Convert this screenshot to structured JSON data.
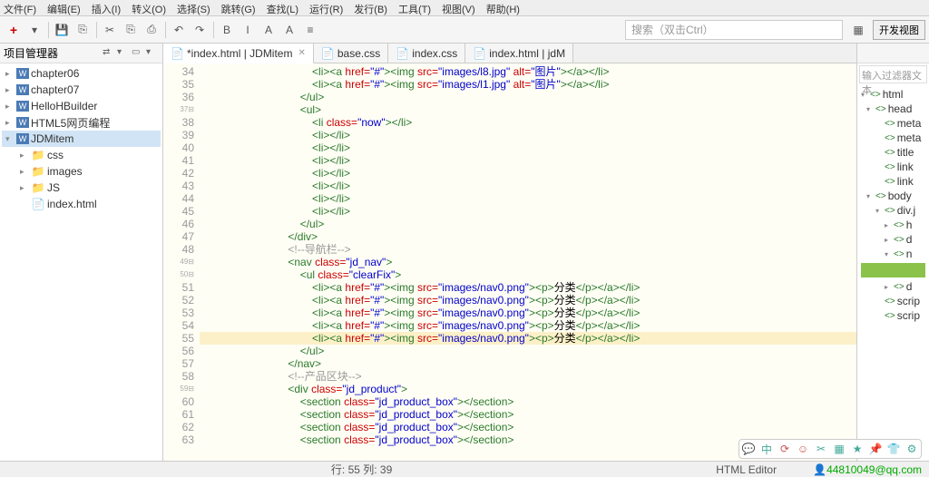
{
  "menubar": [
    "文件(F)",
    "编辑(E)",
    "插入(I)",
    "转义(O)",
    "选择(S)",
    "跳转(G)",
    "查找(L)",
    "运行(R)",
    "发行(B)",
    "工具(T)",
    "视图(V)",
    "帮助(H)"
  ],
  "toolbar": {
    "search_placeholder": "搜索（双击Ctrl）",
    "dev_view": "开发视图"
  },
  "sidebar": {
    "title": "项目管理器",
    "items": [
      {
        "label": "chapter06",
        "type": "w",
        "lvl": 1,
        "arrow": "▸"
      },
      {
        "label": "chapter07",
        "type": "w",
        "lvl": 1,
        "arrow": "▸"
      },
      {
        "label": "HelloHBuilder",
        "type": "w",
        "lvl": 1,
        "arrow": "▸"
      },
      {
        "label": "HTML5网页编程",
        "type": "w",
        "lvl": 1,
        "arrow": "▸"
      },
      {
        "label": "JDMitem",
        "type": "w",
        "lvl": 1,
        "arrow": "▾",
        "selected": true
      },
      {
        "label": "css",
        "type": "folder",
        "lvl": 2,
        "arrow": "▸"
      },
      {
        "label": "images",
        "type": "folder",
        "lvl": 2,
        "arrow": "▸"
      },
      {
        "label": "JS",
        "type": "folder",
        "lvl": 2,
        "arrow": "▸"
      },
      {
        "label": "index.html",
        "type": "file",
        "lvl": 2,
        "arrow": ""
      }
    ]
  },
  "tabs": [
    {
      "label": "*index.html | JDMitem",
      "active": true,
      "close": true
    },
    {
      "label": "base.css",
      "active": false,
      "close": false
    },
    {
      "label": "index.css",
      "active": false,
      "close": false
    },
    {
      "label": "index.html | jdM",
      "active": false,
      "close": false
    }
  ],
  "code_lines": [
    {
      "n": 34,
      "indent": 9,
      "html": "<span class='tag'>&lt;li&gt;&lt;a</span> <span class='attr'>href=</span><span class='val'>\"#\"</span><span class='tag'>&gt;&lt;img</span> <span class='attr'>src=</span><span class='val'>\"images/l8.jpg\"</span> <span class='attr'>alt=</span><span class='val'>\"图片\"</span><span class='tag'>&gt;&lt;/a&gt;&lt;/li&gt;</span>"
    },
    {
      "n": 35,
      "indent": 9,
      "html": "<span class='tag'>&lt;li&gt;&lt;a</span> <span class='attr'>href=</span><span class='val'>\"#\"</span><span class='tag'>&gt;&lt;img</span> <span class='attr'>src=</span><span class='val'>\"images/l1.jpg\"</span> <span class='attr'>alt=</span><span class='val'>\"图片\"</span><span class='tag'>&gt;&lt;/a&gt;&lt;/li&gt;</span>"
    },
    {
      "n": 36,
      "indent": 8,
      "html": "<span class='tag'>&lt;/ul&gt;</span>"
    },
    {
      "n": 37,
      "fold": true,
      "indent": 8,
      "html": "<span class='tag'>&lt;ul&gt;</span>"
    },
    {
      "n": 38,
      "indent": 9,
      "html": "<span class='tag'>&lt;li</span> <span class='attr'>class=</span><span class='val'>\"now\"</span><span class='tag'>&gt;&lt;/li&gt;</span>"
    },
    {
      "n": 39,
      "indent": 9,
      "html": "<span class='tag'>&lt;li&gt;&lt;/li&gt;</span>"
    },
    {
      "n": 40,
      "indent": 9,
      "html": "<span class='tag'>&lt;li&gt;&lt;/li&gt;</span>"
    },
    {
      "n": 41,
      "indent": 9,
      "html": "<span class='tag'>&lt;li&gt;&lt;/li&gt;</span>"
    },
    {
      "n": 42,
      "indent": 9,
      "html": "<span class='tag'>&lt;li&gt;&lt;/li&gt;</span>"
    },
    {
      "n": 43,
      "indent": 9,
      "html": "<span class='tag'>&lt;li&gt;&lt;/li&gt;</span>"
    },
    {
      "n": 44,
      "indent": 9,
      "html": "<span class='tag'>&lt;li&gt;&lt;/li&gt;</span>"
    },
    {
      "n": 45,
      "indent": 9,
      "html": "<span class='tag'>&lt;li&gt;&lt;/li&gt;</span>"
    },
    {
      "n": 46,
      "indent": 8,
      "html": "<span class='tag'>&lt;/ul&gt;</span>"
    },
    {
      "n": 47,
      "indent": 7,
      "html": "<span class='tag'>&lt;/div&gt;</span>"
    },
    {
      "n": 48,
      "indent": 7,
      "html": "<span class='comment'>&lt;!--导航栏--&gt;</span>"
    },
    {
      "n": 49,
      "fold": true,
      "indent": 7,
      "html": "<span class='tag'>&lt;nav</span> <span class='attr'>class=</span><span class='val'>\"jd_nav\"</span><span class='tag'>&gt;</span>"
    },
    {
      "n": 50,
      "fold": true,
      "indent": 8,
      "html": "<span class='tag'>&lt;ul</span> <span class='attr'>class=</span><span class='val'>\"clearFix\"</span><span class='tag'>&gt;</span>"
    },
    {
      "n": 51,
      "indent": 9,
      "html": "<span class='tag'>&lt;li&gt;&lt;a</span> <span class='attr'>href=</span><span class='val'>\"#\"</span><span class='tag'>&gt;&lt;img</span> <span class='attr'>src=</span><span class='val'>\"images/nav0.png\"</span><span class='tag'>&gt;&lt;p&gt;</span><span class='txt'>分类</span><span class='tag'>&lt;/p&gt;&lt;/a&gt;&lt;/li&gt;</span>"
    },
    {
      "n": 52,
      "indent": 9,
      "html": "<span class='tag'>&lt;li&gt;&lt;a</span> <span class='attr'>href=</span><span class='val'>\"#\"</span><span class='tag'>&gt;&lt;img</span> <span class='attr'>src=</span><span class='val'>\"images/nav0.png\"</span><span class='tag'>&gt;&lt;p&gt;</span><span class='txt'>分类</span><span class='tag'>&lt;/p&gt;&lt;/a&gt;&lt;/li&gt;</span>"
    },
    {
      "n": 53,
      "indent": 9,
      "html": "<span class='tag'>&lt;li&gt;&lt;a</span> <span class='attr'>href=</span><span class='val'>\"#\"</span><span class='tag'>&gt;&lt;img</span> <span class='attr'>src=</span><span class='val'>\"images/nav0.png\"</span><span class='tag'>&gt;&lt;p&gt;</span><span class='txt'>分类</span><span class='tag'>&lt;/p&gt;&lt;/a&gt;&lt;/li&gt;</span>"
    },
    {
      "n": 54,
      "indent": 9,
      "html": "<span class='tag'>&lt;li&gt;&lt;a</span> <span class='attr'>href=</span><span class='val'>\"#\"</span><span class='tag'>&gt;&lt;img</span> <span class='attr'>src=</span><span class='val'>\"images/nav0.png\"</span><span class='tag'>&gt;&lt;p&gt;</span><span class='txt'>分类</span><span class='tag'>&lt;/p&gt;&lt;/a&gt;&lt;/li&gt;</span>"
    },
    {
      "n": 55,
      "indent": 9,
      "highlight": true,
      "html": "<span class='tag'>&lt;li&gt;&lt;a</span> <span class='attr'>href=</span><span class='val'>\"#\"</span><span class='tag'>&gt;&lt;img</span> <span class='attr'>src=</span><span class='val'>\"images/nav0.png\"</span><span class='tag'>&gt;&lt;p&gt;</span><span class='txt'>分类</span><span class='tag'>&lt;/p&gt;&lt;/a&gt;&lt;/li&gt;</span>"
    },
    {
      "n": 56,
      "indent": 8,
      "html": "<span class='tag'>&lt;/ul&gt;</span>"
    },
    {
      "n": 57,
      "indent": 7,
      "html": "<span class='tag'>&lt;/nav&gt;</span>"
    },
    {
      "n": 58,
      "indent": 7,
      "html": "<span class='comment'>&lt;!--产品区块--&gt;</span>"
    },
    {
      "n": 59,
      "fold": true,
      "indent": 7,
      "html": "<span class='tag'>&lt;div</span> <span class='attr'>class=</span><span class='val'>\"jd_product\"</span><span class='tag'>&gt;</span>"
    },
    {
      "n": 60,
      "indent": 8,
      "html": "<span class='tag'>&lt;section</span> <span class='attr'>class=</span><span class='val'>\"jd_product_box\"</span><span class='tag'>&gt;&lt;/section&gt;</span>"
    },
    {
      "n": 61,
      "indent": 8,
      "html": "<span class='tag'>&lt;section</span> <span class='attr'>class=</span><span class='val'>\"jd_product_box\"</span><span class='tag'>&gt;&lt;/section&gt;</span>"
    },
    {
      "n": 62,
      "indent": 8,
      "html": "<span class='tag'>&lt;section</span> <span class='attr'>class=</span><span class='val'>\"jd_product_box\"</span><span class='tag'>&gt;&lt;/section&gt;</span>"
    },
    {
      "n": 63,
      "indent": 8,
      "html": "<span class='tag'>&lt;section</span> <span class='attr'>class=</span><span class='val'>\"jd_product_box\"</span><span class='tag'>&gt;&lt;/section&gt;</span>"
    }
  ],
  "right_panel": {
    "filter_placeholder": "输入过滤器文本",
    "items": [
      {
        "label": "html",
        "lvl": 0,
        "arr": "▾"
      },
      {
        "label": "head",
        "lvl": 1,
        "arr": "▾"
      },
      {
        "label": "meta",
        "lvl": 2,
        "arr": ""
      },
      {
        "label": "meta",
        "lvl": 2,
        "arr": ""
      },
      {
        "label": "title",
        "lvl": 2,
        "arr": ""
      },
      {
        "label": "link",
        "lvl": 2,
        "arr": ""
      },
      {
        "label": "link",
        "lvl": 2,
        "arr": ""
      },
      {
        "label": "body",
        "lvl": 1,
        "arr": "▾"
      },
      {
        "label": "div.j",
        "lvl": 2,
        "arr": "▾"
      },
      {
        "label": "h",
        "lvl": 3,
        "arr": "▸"
      },
      {
        "label": "d",
        "lvl": 3,
        "arr": "▸"
      },
      {
        "label": "n",
        "lvl": 3,
        "arr": "▾"
      },
      {
        "label": "",
        "lvl": 4,
        "arr": "",
        "green": true
      },
      {
        "label": "d",
        "lvl": 3,
        "arr": "▸"
      },
      {
        "label": "scrip",
        "lvl": 2,
        "arr": ""
      },
      {
        "label": "scrip",
        "lvl": 2,
        "arr": ""
      }
    ]
  },
  "statusbar": {
    "position": "行: 55 列: 39",
    "editor_type": "HTML Editor",
    "user": "44810049@qq.com"
  }
}
